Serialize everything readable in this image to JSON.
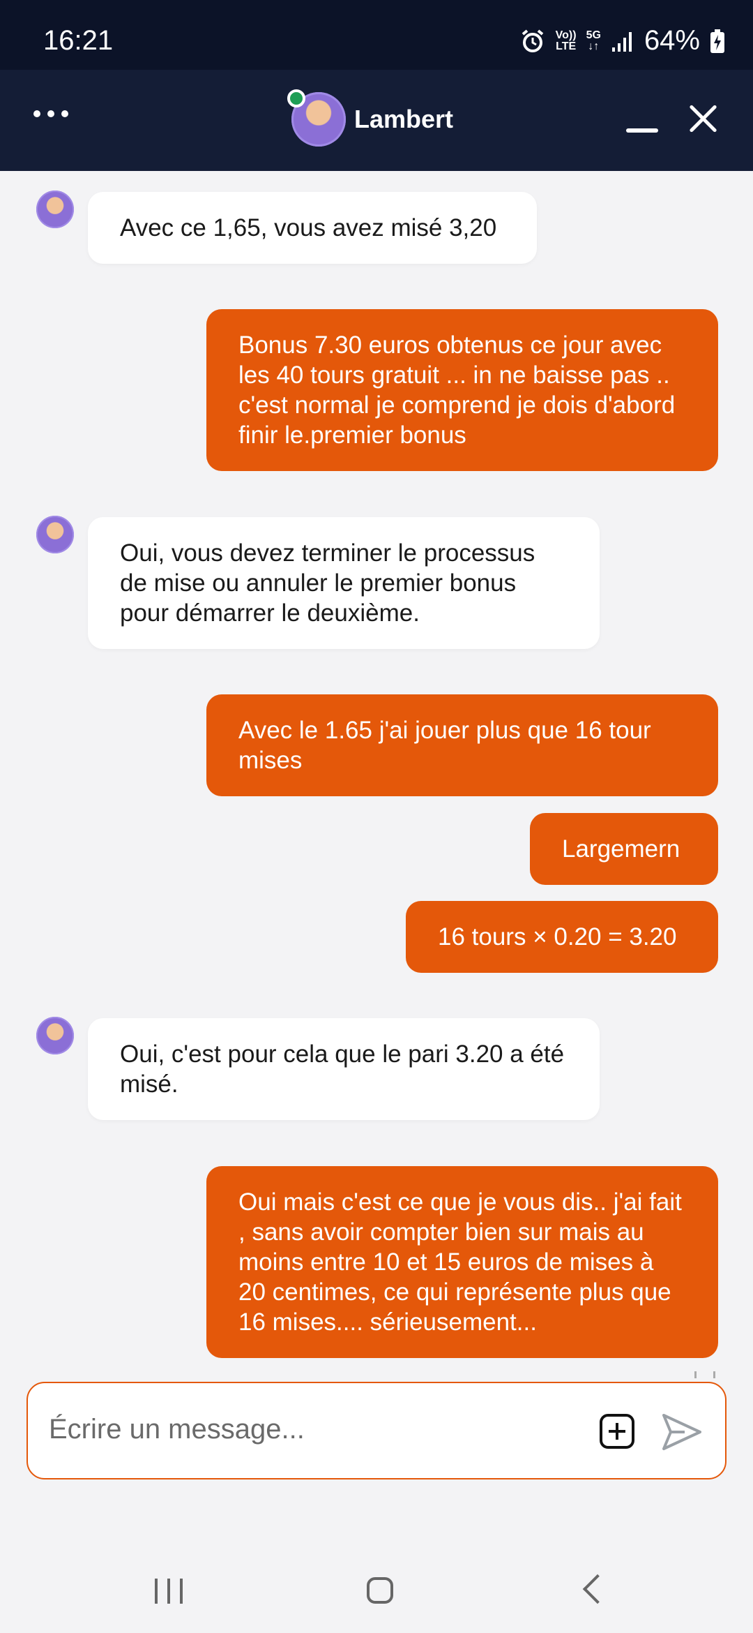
{
  "status_bar": {
    "time": "16:21",
    "volte_line1": "Vo))",
    "volte_line2": "LTE",
    "network": "5G",
    "battery": "64%"
  },
  "header": {
    "agent_name": "Lambert",
    "menu_icon": "more-horizontal-icon",
    "minimize_icon": "minimize-icon",
    "close_icon": "close-icon"
  },
  "messages": [
    {
      "sender": "agent",
      "text": "Avec ce 1,65, vous avez misé 3,20"
    },
    {
      "sender": "user",
      "text": "Bonus 7.30 euros obtenus ce jour avec les 40 tours gratuit ... in ne baisse pas .. c'est normal je comprend je dois d'abord finir le.premier bonus"
    },
    {
      "sender": "agent",
      "text": "Oui, vous devez terminer le processus de mise ou annuler le premier bonus pour démarrer le deuxième."
    },
    {
      "sender": "user",
      "text": "Avec le 1.65 j'ai jouer plus que 16 tour mises"
    },
    {
      "sender": "user",
      "text": "Largemern"
    },
    {
      "sender": "user",
      "text": "16 tours × 0.20 = 3.20"
    },
    {
      "sender": "agent",
      "text": "Oui, c'est pour cela que le pari 3.20 a été misé."
    },
    {
      "sender": "user",
      "text": "Oui mais c'est ce que je vous dis.. j'ai fait , sans avoir compter bien sur mais au moins entre 10 et 15 euros de mises à 20 centimes, ce qui représente plus que 16 mises.... sérieusement..."
    }
  ],
  "composer": {
    "placeholder": "Écrire un message...",
    "attach_icon": "add-attachment-icon",
    "send_icon": "send-icon"
  },
  "colors": {
    "header_bg": "#141d36",
    "user_bubble": "#e4580a",
    "agent_bubble": "#ffffff",
    "accent": "#e4580a"
  }
}
